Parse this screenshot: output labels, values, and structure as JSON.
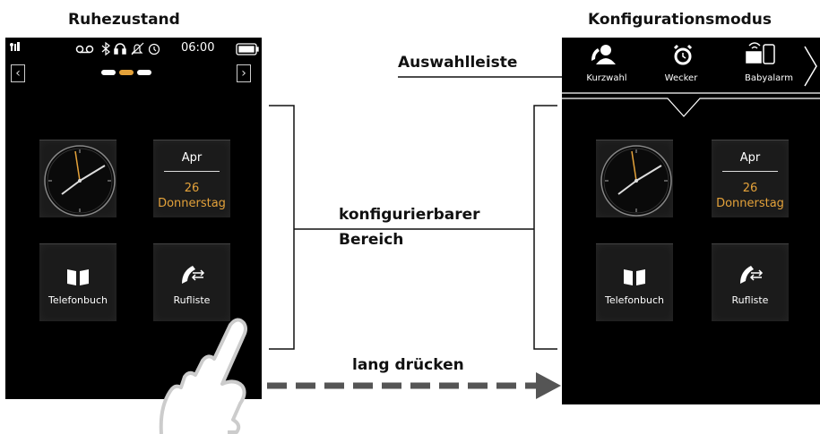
{
  "left": {
    "heading": "Ruhezustand",
    "status": {
      "time": "06:00"
    },
    "calendar": {
      "month": "Apr",
      "day": "26",
      "weekday": "Donnerstag"
    },
    "tiles": {
      "phonebook": "Telefonbuch",
      "calllist": "Rufliste"
    }
  },
  "right": {
    "heading": "Konfigurationsmodus",
    "selection": [
      "Kurzwahl",
      "Wecker",
      "Babyalarm"
    ],
    "calendar": {
      "month": "Apr",
      "day": "26",
      "weekday": "Donnerstag"
    },
    "tiles": {
      "phonebook": "Telefonbuch",
      "calllist": "Rufliste"
    }
  },
  "annotations": {
    "selection_bar": "Auswahlleiste",
    "configurable_line1": "konfigurierbarer",
    "configurable_line2": "Bereich",
    "long_press": "lang drücken"
  },
  "colors": {
    "accent": "#e4a23a",
    "screen_bg": "#000000",
    "arrow": "#555555"
  },
  "icons": [
    "signal-icon",
    "voicemail-icon",
    "bluetooth-icon",
    "headset-icon",
    "silent-icon",
    "alarm-icon",
    "battery-icon",
    "clock-icon",
    "book-icon",
    "call-list-icon",
    "speed-dial-icon",
    "alarm-clock-icon",
    "baby-monitor-icon",
    "chevron-right-icon",
    "finger-icon"
  ]
}
